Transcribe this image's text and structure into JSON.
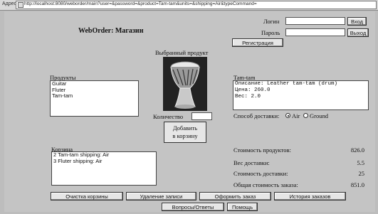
{
  "browser": {
    "address_label": "Адрес:",
    "url": "http://localhost:8080/weborder/main?user=&password=&product=Tam-tam&units=&shipping=Air&typeCommand="
  },
  "header": {
    "title": "WebOrder: Магазин"
  },
  "login": {
    "login_label": "Логин",
    "password_label": "Пароль",
    "login_value": "",
    "password_value": "",
    "login_button": "Вход",
    "password_button": "Выход",
    "register_button": "Регистрация"
  },
  "product": {
    "selected_label": "Выбранный продукт",
    "quantity_label": "Количество",
    "quantity_value": "",
    "add_button_line1": "Добавить",
    "add_button_line2": "в корзину"
  },
  "products": {
    "label": "Продукты",
    "items": [
      "Guitar",
      "Fluter",
      "Tam-tam"
    ]
  },
  "details": {
    "label": "Tam-tam",
    "lines": [
      "Описание: Leather tam-tam (drum)",
      "Цена: 260.0",
      "Вес: 2.0"
    ]
  },
  "shipping": {
    "label": "Способ доставки:",
    "options": [
      "Air",
      "Ground"
    ],
    "selected": "Air"
  },
  "cart": {
    "label": "Корзина",
    "items": [
      "2 Tam-tam shipping: Air",
      "3 Fluter shipping: Air"
    ]
  },
  "summary": {
    "rows": [
      {
        "label": "Стоимость продуктов:",
        "value": "826.0"
      },
      {
        "label": "Вес доставки:",
        "value": "5.5"
      },
      {
        "label": "Стоимость доставки:",
        "value": "25"
      },
      {
        "label": "Общая стоимость заказа:",
        "value": "851.0"
      }
    ]
  },
  "actions": {
    "clear_cart": "Очистка корзины",
    "delete_item": "Удаление записи",
    "checkout": "Оформить заказ",
    "history": "История заказов",
    "faq": "Вопросы/Ответы",
    "help": "Помощь"
  }
}
